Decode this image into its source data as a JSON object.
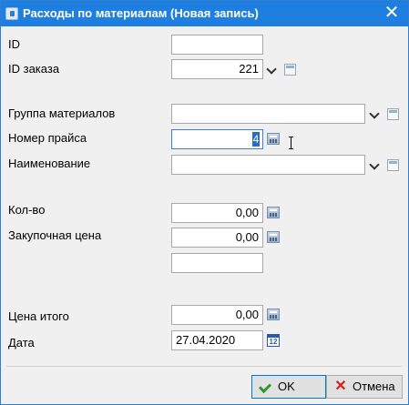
{
  "window": {
    "title": "Расходы по материалам (Новая запись)",
    "close_glyph": "✕"
  },
  "labels": {
    "id": "ID",
    "order_id": "ID заказа",
    "material_group": "Группа материалов",
    "price_number": "Номер прайса",
    "name": "Наименование",
    "qty": "Кол-во",
    "purchase_price": "Закупочная цена",
    "total_price": "Цена итого",
    "date": "Дата"
  },
  "values": {
    "id": "",
    "order_id": "221",
    "material_group": "",
    "price_number": "",
    "price_number_caret": "4",
    "name": "",
    "qty": "0,00",
    "purchase_price": "0,00",
    "extra": "",
    "total_price": "0,00",
    "date": "27.04.2020",
    "date_icon_text": "12"
  },
  "buttons": {
    "ok": "OK",
    "cancel": "Отмена"
  }
}
